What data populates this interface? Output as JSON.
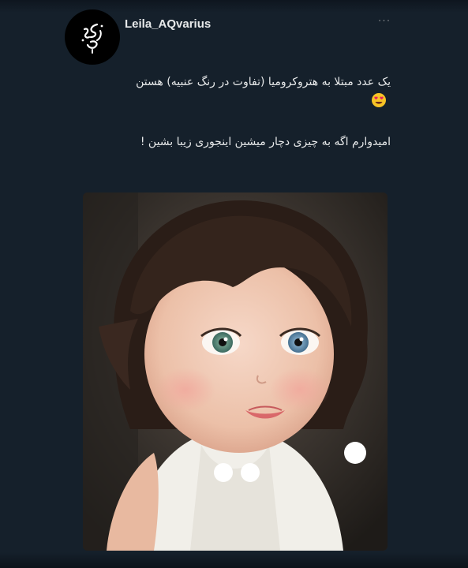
{
  "post": {
    "username": "Leila_AQvarius",
    "more_icon": "more-dots-icon",
    "text_line_1": "یک عدد مبتلا به هتروکرومیا (تفاوت در رنگ عنبیه) هستن",
    "text_emoji": "heart-eyes-emoji",
    "text_line_2": "امیدوارم اگه به چیزی دچار میشین اینجوری زیبا بشین !"
  },
  "colors": {
    "background": "#15202b",
    "text": "#e7e9ea",
    "muted": "#71767b"
  }
}
